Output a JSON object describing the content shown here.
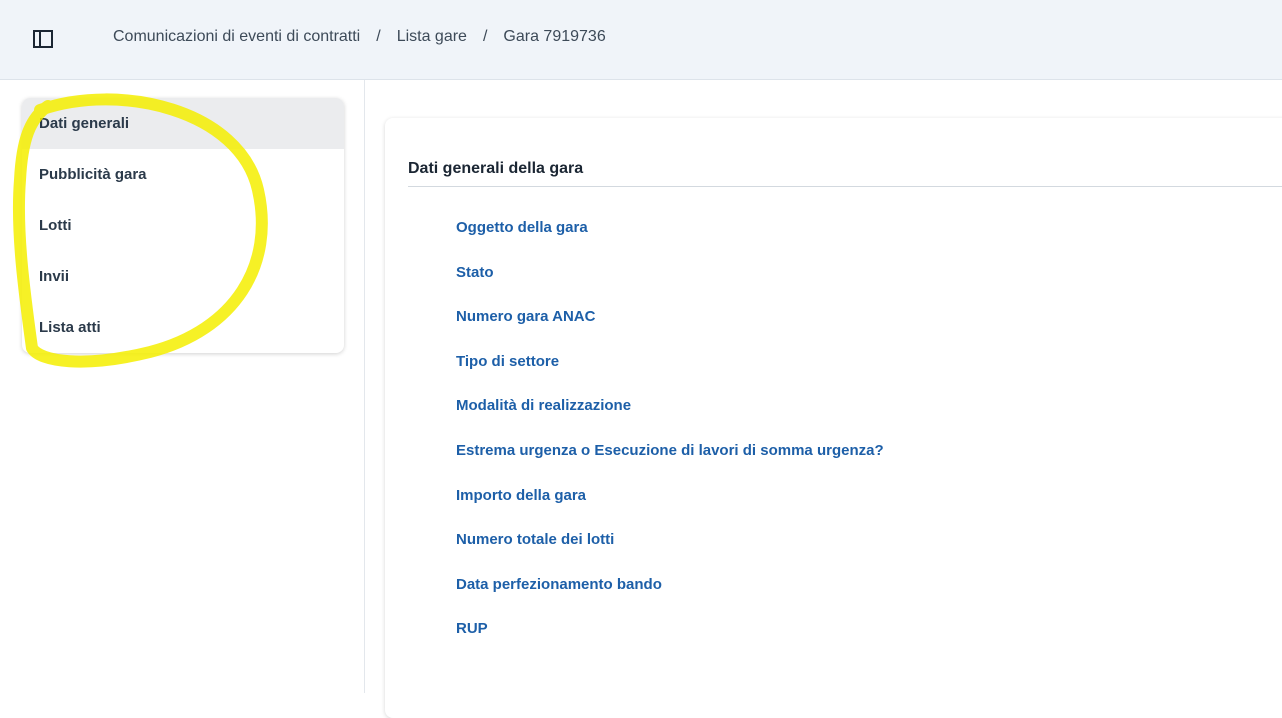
{
  "breadcrumb": {
    "items": [
      "Comunicazioni di eventi di contratti",
      "Lista gare",
      "Gara 7919736"
    ],
    "separator": "/"
  },
  "sidebar": {
    "toggle_icon": "sidebar-toggle-icon",
    "items": [
      {
        "label": "Dati generali",
        "active": true
      },
      {
        "label": "Pubblicità gara",
        "active": false
      },
      {
        "label": "Lotti",
        "active": false
      },
      {
        "label": "Invii",
        "active": false
      },
      {
        "label": "Lista atti",
        "active": false
      }
    ]
  },
  "main": {
    "section_title": "Dati generali della gara",
    "fields": [
      "Oggetto della gara",
      "Stato",
      "Numero gara ANAC",
      "Tipo di settore",
      "Modalità di realizzazione",
      "Estrema urgenza o Esecuzione di lavori di somma urgenza?",
      "Importo della gara",
      "Numero totale dei lotti",
      "Data perfezionamento bando",
      "RUP"
    ]
  },
  "colors": {
    "topbar_bg": "#f0f4f9",
    "field_label": "#1d5fa8",
    "active_nav_bg": "#ebecee",
    "highlight_marker": "#f4ef00"
  }
}
